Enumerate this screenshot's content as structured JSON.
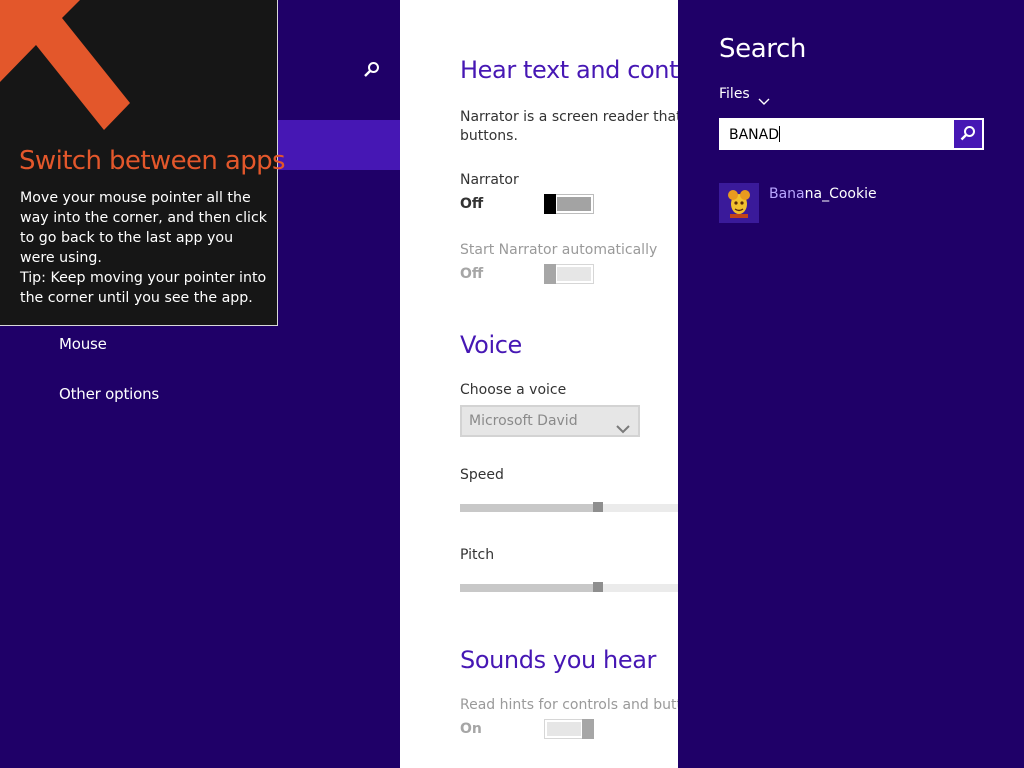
{
  "settings_nav": {
    "items": [
      "Mouse",
      "Other options"
    ]
  },
  "tip": {
    "title": "Switch between apps",
    "body": "Move your mouse pointer all the way into the corner, and then click to go back to the last app you were using.",
    "tip": "Tip: Keep moving your pointer into the corner until you see the app."
  },
  "content": {
    "hear_heading": "Hear text and contro",
    "narrator_desc": "Narrator is a screen reader that rea buttons.",
    "narrator_label": "Narrator",
    "narrator_state": "Off",
    "auto_label": "Start Narrator automatically",
    "auto_state": "Off",
    "voice_heading": "Voice",
    "choose_voice_label": "Choose a voice",
    "voice_value": "Microsoft David",
    "speed_label": "Speed",
    "speed_level": 0.58,
    "pitch_label": "Pitch",
    "pitch_level": 0.58,
    "sounds_heading": "Sounds you hear",
    "hints_label": "Read hints for controls and buttons",
    "hints_state": "On"
  },
  "search_charm": {
    "title": "Search",
    "scope": "Files",
    "query": "BANAD",
    "result": {
      "match": "Bana",
      "rest": "na_Cookie"
    }
  },
  "colors": {
    "accent": "#4617b4",
    "background": "#1f0068",
    "tip_title": "#e3572b"
  },
  "icons": [
    "search-icon",
    "chevron-down-icon",
    "corner-arrow-icon",
    "banana-cookie-icon"
  ]
}
